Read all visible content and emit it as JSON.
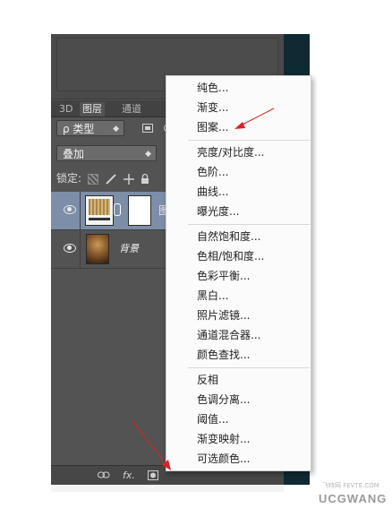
{
  "panel": {
    "tabs": [
      {
        "label": "3D"
      },
      {
        "label": "图层",
        "active": true
      },
      {
        "label": "通道"
      }
    ],
    "filter": {
      "label": "ρ 类型"
    },
    "blend_mode": {
      "value": "叠加"
    },
    "lock": {
      "label": "锁定:"
    },
    "layers": [
      {
        "name": "图",
        "selected": true,
        "thumbnail": "pattern-thumbnail",
        "has_mask": true
      },
      {
        "name": "背景",
        "selected": false,
        "thumbnail": "photo-thumbnail"
      }
    ],
    "footer_icons": [
      "link-icon",
      "fx-icon",
      "mask-icon",
      "adjustment-layer-icon",
      "folder-icon",
      "new-layer-icon",
      "trash-icon"
    ],
    "fx_label": "fx."
  },
  "adjustment_menu": {
    "groups": [
      [
        "纯色...",
        "渐变...",
        "图案..."
      ],
      [
        "亮度/对比度...",
        "色阶...",
        "曲线...",
        "曝光度..."
      ],
      [
        "自然饱和度...",
        "色相/饱和度...",
        "色彩平衡...",
        "黑白...",
        "照片滤镜...",
        "通道混合器...",
        "颜色查找..."
      ],
      [
        "反相",
        "色调分离...",
        "阈值...",
        "渐变映射...",
        "可选颜色..."
      ]
    ]
  },
  "watermark": {
    "text": "UCGWANG",
    "subtext": "飞特网 FEVTE.COM"
  },
  "colors": {
    "annotation_arrow": "#e02020",
    "selected_layer": "#7d8ea8",
    "panel_bg": "#535353"
  }
}
